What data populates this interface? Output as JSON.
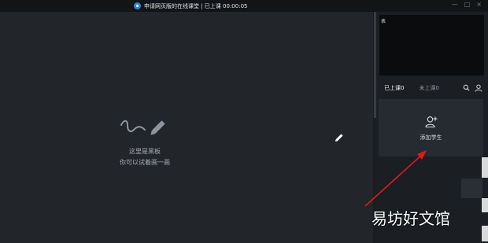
{
  "window": {
    "title": "申请网页版的在线课堂 | 已上课 00:00:05"
  },
  "whiteboard": {
    "placeholder_line1": "这里是黑板",
    "placeholder_line2": "你可以试着画一画"
  },
  "video": {
    "label": "表"
  },
  "tabs": [
    {
      "label": "已上课0",
      "active": true
    },
    {
      "label": "未上课0",
      "active": false
    }
  ],
  "add_student": {
    "label": "添加学生"
  },
  "watermark": "易坊好文馆",
  "colors": {
    "arrow": "#e01b1b",
    "accent": "#2f86d6"
  }
}
